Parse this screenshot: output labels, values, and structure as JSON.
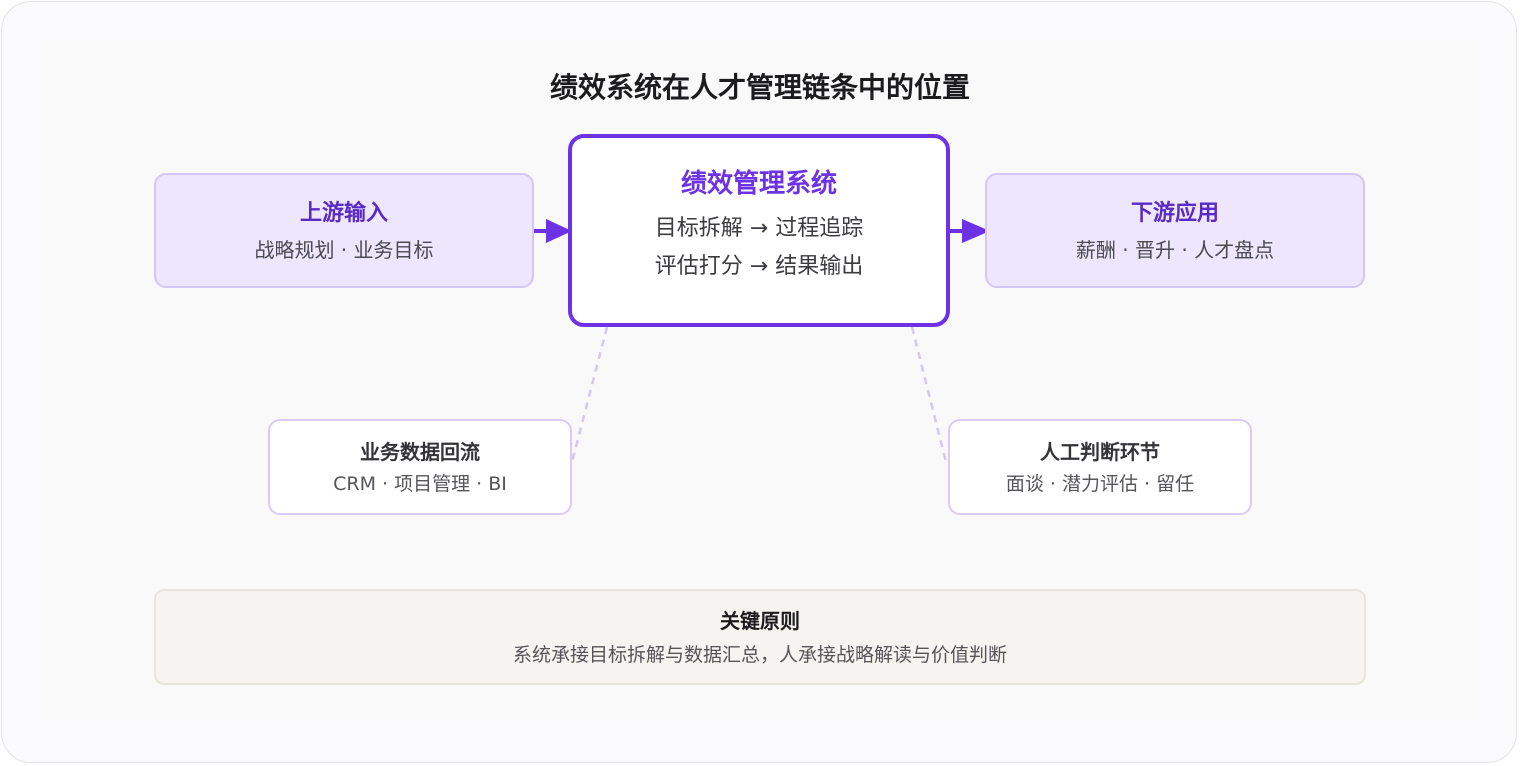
{
  "diagram": {
    "title": "绩效系统在人才管理链条中的位置",
    "upstream": {
      "heading": "上游输入",
      "detail": "战略规划 · 业务目标"
    },
    "center": {
      "heading": "绩效管理系统",
      "line1": "目标拆解 → 过程追踪",
      "line2": "评估打分 → 结果输出"
    },
    "downstream": {
      "heading": "下游应用",
      "detail": "薪酬 · 晋升 · 人才盘点"
    },
    "data_feedback": {
      "heading": "业务数据回流",
      "detail": "CRM · 项目管理 · BI"
    },
    "human_judgment": {
      "heading": "人工判断环节",
      "detail": "面谈 · 潜力评估 · 留任"
    },
    "principle": {
      "heading": "关键原则",
      "detail": "系统承接目标拆解与数据汇总，人承接战略解读与价值判断"
    },
    "colors": {
      "accent": "#6d32e6",
      "side_fill": "#ede6fd",
      "dashed_link": "#d4c6f6"
    }
  }
}
